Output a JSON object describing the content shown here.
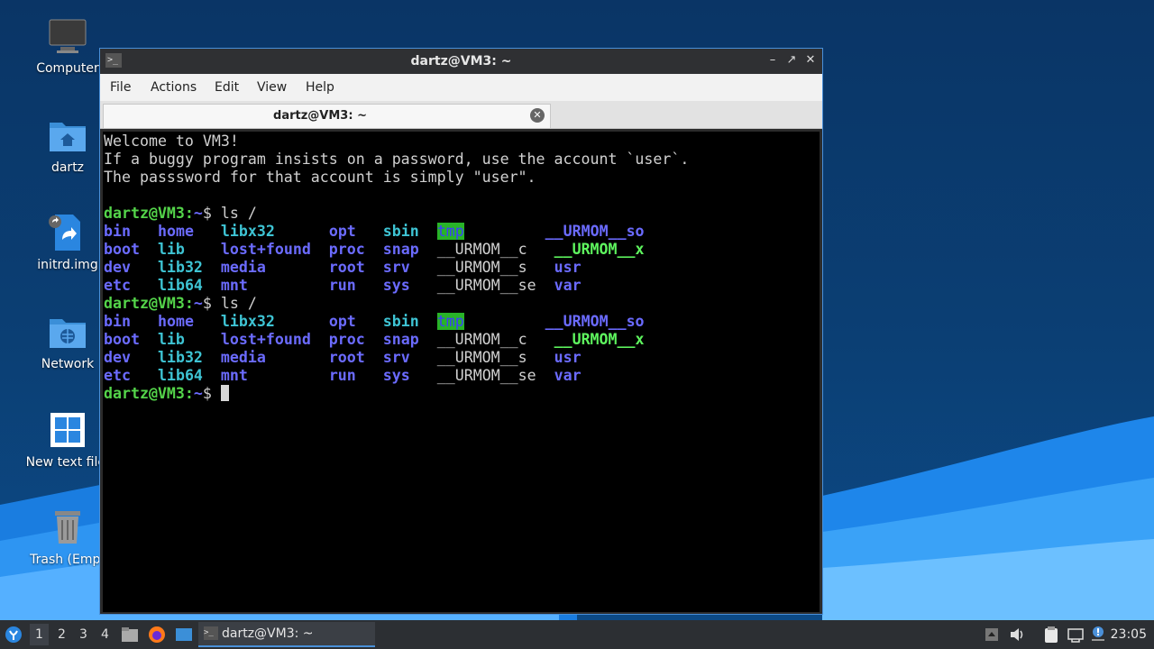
{
  "desktop": {
    "icons": [
      {
        "label": "Computer",
        "icon": "computer-icon"
      },
      {
        "label": "dartz",
        "icon": "home-folder-icon"
      },
      {
        "label": "initrd.img",
        "icon": "link-file-icon"
      },
      {
        "label": "Network",
        "icon": "network-folder-icon"
      },
      {
        "label": "New text file.",
        "icon": "windows-file-icon"
      },
      {
        "label": "Trash (Empt",
        "icon": "trash-icon"
      }
    ]
  },
  "window": {
    "title": "dartz@VM3: ~",
    "menu": [
      "File",
      "Actions",
      "Edit",
      "View",
      "Help"
    ],
    "tab_title": "dartz@VM3: ~"
  },
  "terminal": {
    "welcome": [
      "Welcome to VM3!",
      "If a buggy program insists on a password, use the account `user`.",
      "The passsword for that account is simply \"user\"."
    ],
    "prompt": "dartz@VM3:",
    "path": "~",
    "command": "ls /",
    "listing": [
      [
        "bin",
        "home",
        "libx32",
        "opt",
        "sbin",
        "tmp",
        "__URMOM__so"
      ],
      [
        "boot",
        "lib",
        "lost+found",
        "proc",
        "snap",
        "__URMOM__c",
        "__URMOM__x"
      ],
      [
        "dev",
        "lib32",
        "media",
        "root",
        "srv",
        "__URMOM__s",
        "usr"
      ],
      [
        "etc",
        "lib64",
        "mnt",
        "run",
        "sys",
        "__URMOM__se",
        "var"
      ]
    ]
  },
  "taskbar": {
    "workspaces": [
      "1",
      "2",
      "3",
      "4"
    ],
    "task_title": "dartz@VM3: ~",
    "clock": "23:05"
  },
  "colors": {
    "accent": "#4a90d9",
    "prompt_green": "#54d44a",
    "dir_blue": "#6b6bff"
  }
}
